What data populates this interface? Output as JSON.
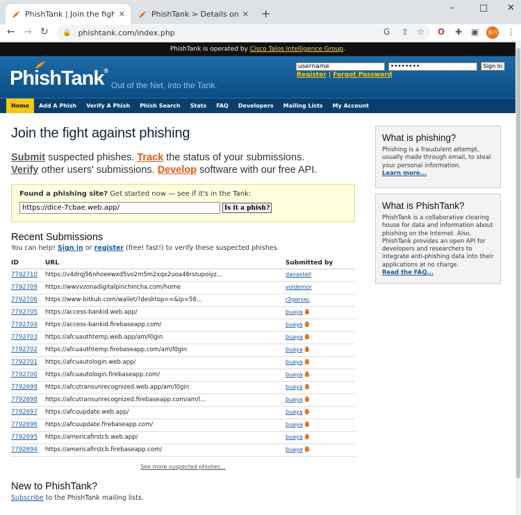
{
  "browser": {
    "tabs": [
      {
        "title": "PhishTank | Join the fight agains"
      },
      {
        "title": "PhishTank > Details on suspecte"
      }
    ],
    "url": "phishtank.com/index.php",
    "window_controls": [
      "–",
      "□",
      "✕"
    ],
    "profile_label": "동기"
  },
  "operated_bar": {
    "prefix": "PhishTank is operated by ",
    "link": "Cisco Talos Intelligence Group",
    "suffix": "."
  },
  "header": {
    "logo": "PhishTank",
    "logo_mark": "®",
    "tagline": "Out of the Net, into the Tank.",
    "username_value": "username",
    "password_value": "••••••••",
    "signin_label": "Sign In",
    "register_label": "Register",
    "separator": "|",
    "forgot_label": "Forgot Password"
  },
  "nav": [
    "Home",
    "Add A Phish",
    "Verify A Phish",
    "Phish Search",
    "Stats",
    "FAQ",
    "Developers",
    "Mailing Lists",
    "My Account"
  ],
  "main": {
    "title": "Join the fight against phishing",
    "line1": {
      "verb": "Submit",
      "rest": " suspected phishes. ",
      "verb2": "Track",
      "rest2": " the status of your submissions."
    },
    "line2": {
      "verb": "Verify",
      "rest": " other users' submissions. ",
      "verb2": "Develop",
      "rest2": " software with our free API."
    },
    "find_label_bold": "Found a phishing site?",
    "find_label_rest": " Get started now — see if it's in the Tank:",
    "find_value": "https://dice-7cbae.web.app/",
    "find_button": "Is it a phish?",
    "recent_title": "Recent Submissions",
    "help_prefix": "You can help! ",
    "help_signin": "Sign in",
    "help_or": " or ",
    "help_register": "register",
    "help_suffix": " (free! fast!) to verify these suspected phishes.",
    "columns": [
      "ID",
      "URL",
      "Submitted by"
    ],
    "rows": [
      {
        "id": "7792710",
        "url": "https://v4drqj56nhoeewxd5vo2m5m2xqx2uoa46rstupoiyz...",
        "by": "danaxtell",
        "flame": false
      },
      {
        "id": "7792709",
        "url": "https://wwvvzonadigitalpinchincha.com/home",
        "by": "voldemor",
        "flame": false
      },
      {
        "id": "7792706",
        "url": "https://www-bitkub.com/wallet/?desktop==&ip=58...",
        "by": "r3gersec",
        "flame": false
      },
      {
        "id": "7792705",
        "url": "https://access-bankid.web.app/",
        "by": "buaya",
        "flame": true
      },
      {
        "id": "7792704",
        "url": "https://access-bankid.firebaseapp.com/",
        "by": "buaya",
        "flame": true
      },
      {
        "id": "7792703",
        "url": "https://afcuauthtemp.web.app/am/l0gin",
        "by": "buaya",
        "flame": true
      },
      {
        "id": "7792702",
        "url": "https://afcuauthtemp.firebaseapp.com/am/l0gin",
        "by": "buaya",
        "flame": true
      },
      {
        "id": "7792701",
        "url": "https://afcuautologin.web.app/",
        "by": "buaya",
        "flame": true
      },
      {
        "id": "7792700",
        "url": "https://afcuautologin.firebaseapp.com/",
        "by": "buaya",
        "flame": true
      },
      {
        "id": "7792699",
        "url": "https://afcutransunrecognized.web.app/am/l0gin",
        "by": "buaya",
        "flame": true
      },
      {
        "id": "7792698",
        "url": "https://afcutransunrecognized.firebaseapp.com/am/l...",
        "by": "buaya",
        "flame": true
      },
      {
        "id": "7792697",
        "url": "https://afcuupdate.web.app/",
        "by": "buaya",
        "flame": true
      },
      {
        "id": "7792696",
        "url": "https://afcuupdate.firebaseapp.com/",
        "by": "buaya",
        "flame": true
      },
      {
        "id": "7792695",
        "url": "https://americafirstcb.web.app/",
        "by": "buaya",
        "flame": true
      },
      {
        "id": "7792694",
        "url": "https://americafirstcb.firebaseapp.com/",
        "by": "buaya",
        "flame": true
      }
    ],
    "see_more": "See more suspected phishes...",
    "new_title": "New to PhishTank?",
    "subscribe_link": "Subscribe",
    "subscribe_rest": " to the PhishTank mailing lists."
  },
  "sidebar": {
    "what_phishing_title": "What is phishing?",
    "what_phishing_text": "Phishing is a fraudulent attempt, usually made through email, to steal your personal information.",
    "learn_more": "Learn more...",
    "what_phishtank_title": "What is PhishTank?",
    "what_phishtank_text": "PhishTank is a collaborative clearing house for data and information about phishing on the Internet. Also, PhishTank provides an open API for developers and researchers to integrate anti-phishing data into their applications at no charge.",
    "read_faq": "Read the FAQ..."
  },
  "colors": {
    "header_blue": "#0c4d85",
    "nav_active": "#f5c71a",
    "accent_orange": "#e05a10",
    "link_blue": "#1a5a9c"
  }
}
